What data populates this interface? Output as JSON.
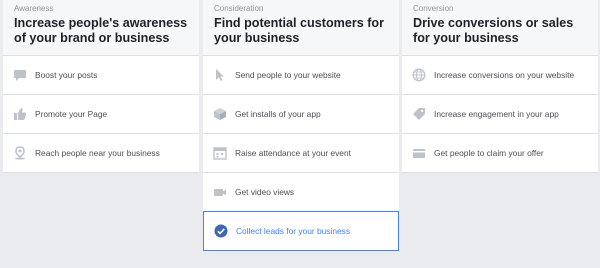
{
  "colors": {
    "background": "#e9ebee",
    "panel": "#ffffff",
    "header_bg": "#f6f7f9",
    "icon_gray": "#bec2c9",
    "selected_blue": "#4080ff",
    "selected_check_bg": "#4267b2"
  },
  "columns": [
    {
      "eyebrow": "Awareness",
      "heading": "Increase people's awareness of your brand or business",
      "items": [
        {
          "label": "Boost your posts",
          "icon": "speech-bubble-icon"
        },
        {
          "label": "Promote your Page",
          "icon": "thumbs-up-icon"
        },
        {
          "label": "Reach people near your business",
          "icon": "location-pin-icon"
        }
      ]
    },
    {
      "eyebrow": "Consideration",
      "heading": "Find potential customers for your business",
      "items": [
        {
          "label": "Send people to your website",
          "icon": "cursor-icon"
        },
        {
          "label": "Get installs of your app",
          "icon": "cube-icon"
        },
        {
          "label": "Raise attendance at your event",
          "icon": "calendar-icon"
        },
        {
          "label": "Get video views",
          "icon": "video-camera-icon"
        },
        {
          "label": "Collect leads for your business",
          "icon": "checkmark-circle-icon",
          "selected": true
        }
      ]
    },
    {
      "eyebrow": "Conversion",
      "heading": "Drive conversions or sales for your business",
      "items": [
        {
          "label": "Increase conversions on your website",
          "icon": "globe-icon"
        },
        {
          "label": "Increase engagement in your app",
          "icon": "tag-icon"
        },
        {
          "label": "Get people to claim your offer",
          "icon": "offer-card-icon"
        }
      ]
    }
  ]
}
